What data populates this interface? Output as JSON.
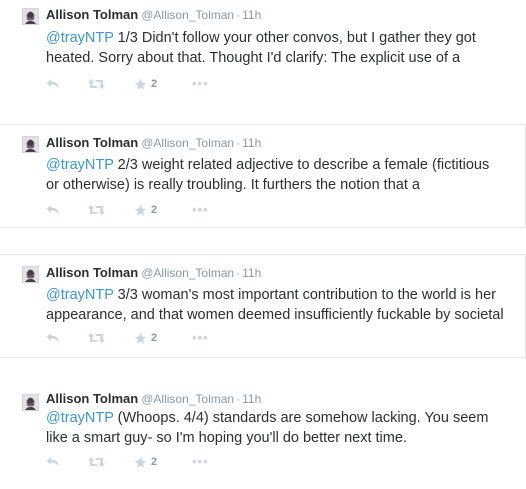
{
  "tweets": [
    {
      "name": "Allison Tolman",
      "handle": "@Allison_Tolman",
      "dot": "·",
      "time": "11h",
      "mention": "@trayNTP",
      "line1": " 1/3 Didn't follow your other convos, but I gather they got",
      "line2": "heated. Sorry about that. Thought I'd clarify: The explicit use of a",
      "favorites": "2",
      "more": "•••"
    },
    {
      "name": "Allison Tolman",
      "handle": "@Allison_Tolman",
      "dot": "·",
      "time": "11h",
      "mention": "@trayNTP",
      "line1": " 2/3 weight related adjective to describe a female (fictitious",
      "line2": "or otherwise) is really troubling. It furthers the notion that a",
      "favorites": "2",
      "more": "•••"
    },
    {
      "name": "Allison Tolman",
      "handle": "@Allison_Tolman",
      "dot": "·",
      "time": "11h",
      "mention": "@trayNTP",
      "line1": " 3/3 woman's most important contribution to the world is her",
      "line2": "appearance, and that women deemed insufficiently fuckable by societal",
      "favorites": "2",
      "more": "•••"
    },
    {
      "name": "Allison Tolman",
      "handle": "@Allison_Tolman",
      "dot": "·",
      "time": "11h",
      "mention": "@trayNTP",
      "line1": " (Whoops. 4/4) standards are somehow lacking. You seem",
      "line2": "like a smart guy- so I'm hoping you'll do better next time.",
      "favorites": "2",
      "more": "•••"
    }
  ],
  "colors": {
    "mention": "#3b94d9",
    "meta": "#8899a6",
    "icon": "#ccd6dd",
    "border": "#e1e8ed"
  },
  "icons": [
    "reply-icon",
    "retweet-icon",
    "favorite-star-icon",
    "more-options-icon",
    "avatar"
  ]
}
